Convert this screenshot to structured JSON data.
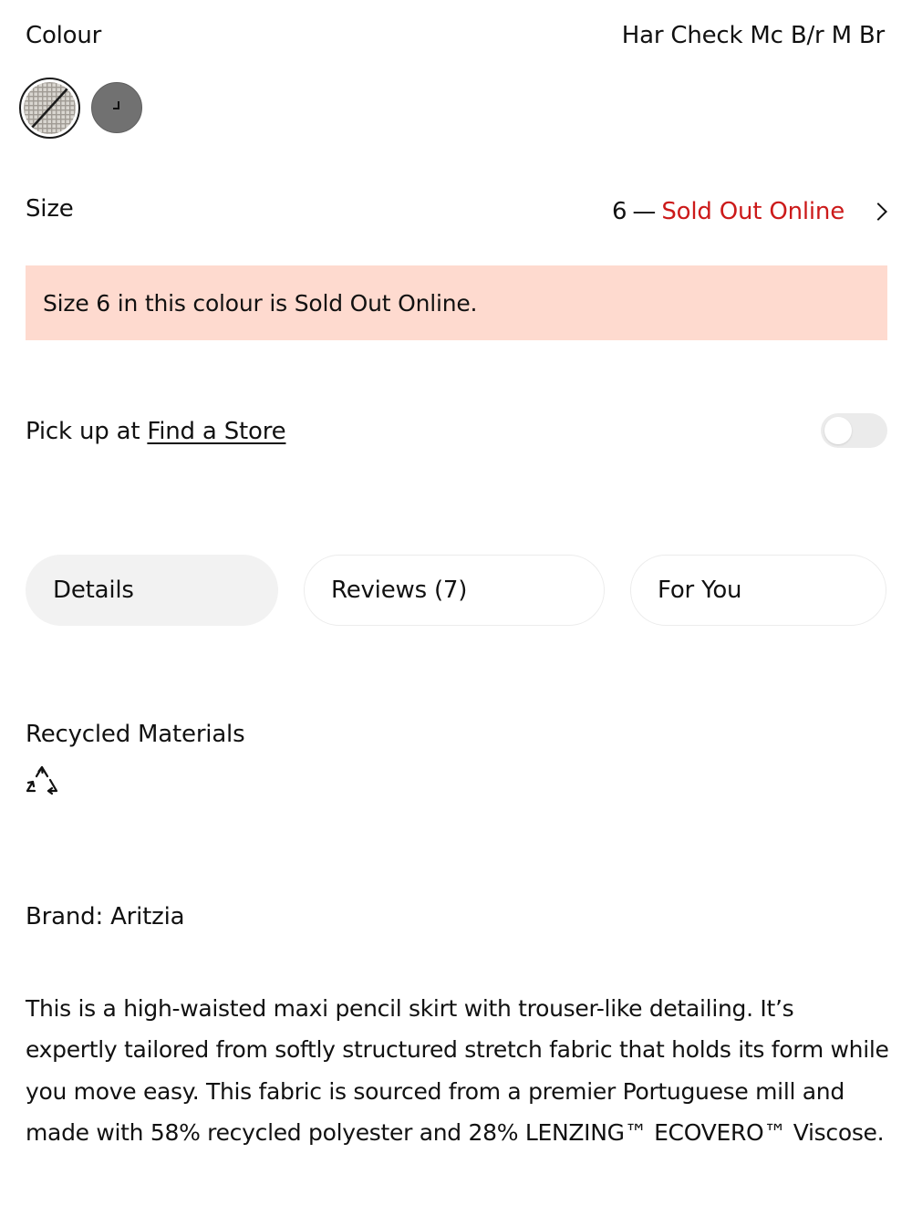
{
  "colour": {
    "label": "Colour",
    "selected_value": "Har Check Mc B/r M Br",
    "swatches": [
      {
        "name": "Har Check Mc B/r M Br",
        "pattern": "check",
        "selected": true,
        "unavailable": true
      },
      {
        "name": "grey",
        "color": "#717171",
        "selected": false
      }
    ]
  },
  "size": {
    "label": "Size",
    "selected_value": "6",
    "separator": "—",
    "status": "Sold Out Online",
    "status_color": "#cc1a1a"
  },
  "banner": {
    "message": "Size 6 in this colour is Sold Out Online.",
    "background": "#fedacf"
  },
  "pickup": {
    "prefix": "Pick up at ",
    "link_label": "Find a Store",
    "toggle_on": false
  },
  "tabs": [
    {
      "label": "Details",
      "active": true
    },
    {
      "label": "Reviews (7)",
      "active": false
    },
    {
      "label": "For You",
      "active": false
    }
  ],
  "recycled": {
    "title": "Recycled Materials",
    "icon": "recycle-icon"
  },
  "brand": {
    "text": "Brand: Aritzia"
  },
  "description": "This is a high-waisted maxi pencil skirt with trouser-like detailing. It’s expertly tailored from softly structured stretch fabric that holds its form while you move easy. This fabric is sourced from a premier Portuguese mill and made with 58% recycled polyester and 28% LENZING™ ECOVERO™ Viscose."
}
